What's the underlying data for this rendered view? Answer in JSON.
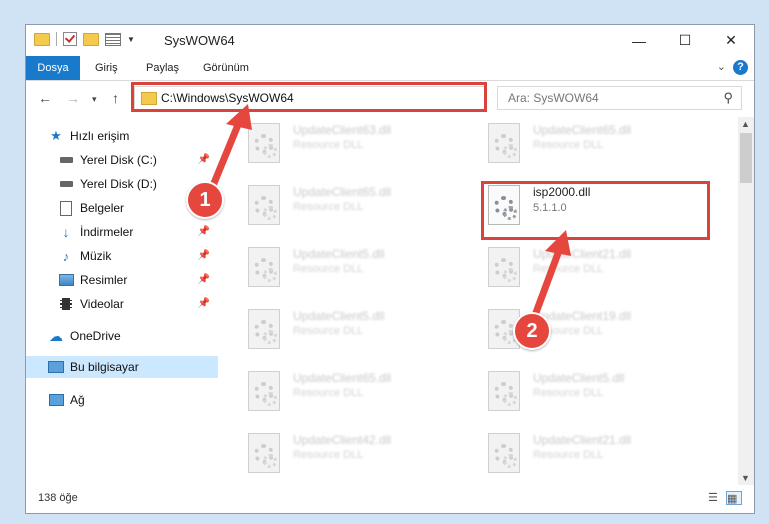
{
  "window": {
    "title": "SysWOW64",
    "controls": {
      "minimize": "—",
      "maximize": "☐",
      "close": "✕"
    }
  },
  "ribbon": {
    "tabs": [
      "Dosya",
      "Giriş",
      "Paylaş",
      "Görünüm"
    ],
    "help": "?",
    "expand": "⌄"
  },
  "address": {
    "path": "C:\\Windows\\SysWOW64",
    "search_placeholder": "Ara: SysWOW64"
  },
  "sidebar": {
    "quick_access": "Hızlı erişim",
    "items": [
      {
        "label": "Yerel Disk (C:)",
        "pinned": true
      },
      {
        "label": "Yerel Disk (D:)",
        "pinned": false
      },
      {
        "label": "Belgeler",
        "pinned": true
      },
      {
        "label": "İndirmeler",
        "pinned": true
      },
      {
        "label": "Müzik",
        "pinned": true
      },
      {
        "label": "Resimler",
        "pinned": true
      },
      {
        "label": "Videolar",
        "pinned": true
      }
    ],
    "onedrive": "OneDrive",
    "this_pc": "Bu bilgisayar",
    "network": "Ağ"
  },
  "files": {
    "left_column": [
      {
        "name": "UpdateClient63.dll",
        "desc": "Resource DLL"
      },
      {
        "name": "UpdateClient65.dll",
        "desc": "Resource DLL"
      },
      {
        "name": "UpdateClient5.dll",
        "desc": "Resource DLL"
      },
      {
        "name": "UpdateClient5.dll",
        "desc": "Resource DLL"
      },
      {
        "name": "UpdateClient65.dll",
        "desc": "Resource DLL"
      },
      {
        "name": "UpdateClient42.dll",
        "desc": "Resource DLL"
      }
    ],
    "right_column": [
      {
        "name": "UpdateClient65.dll",
        "desc": "Resource DLL"
      },
      {
        "name": "isp2000.dll",
        "desc": "5.1.1.0"
      },
      {
        "name": "UpdateClient21.dll",
        "desc": "Resource DLL"
      },
      {
        "name": "UpdateClient19.dll",
        "desc": "Resource DLL"
      },
      {
        "name": "UpdateClient5.dll",
        "desc": "Resource DLL"
      },
      {
        "name": "UpdateClient21.dll",
        "desc": "Resource DLL"
      }
    ]
  },
  "status": {
    "count": "138 öğe"
  },
  "annotations": {
    "step1": "1",
    "step2": "2",
    "color": "#e5473f"
  },
  "colors": {
    "accent": "#1979ca",
    "selection": "#cce8ff",
    "highlight": "#d9433b"
  }
}
